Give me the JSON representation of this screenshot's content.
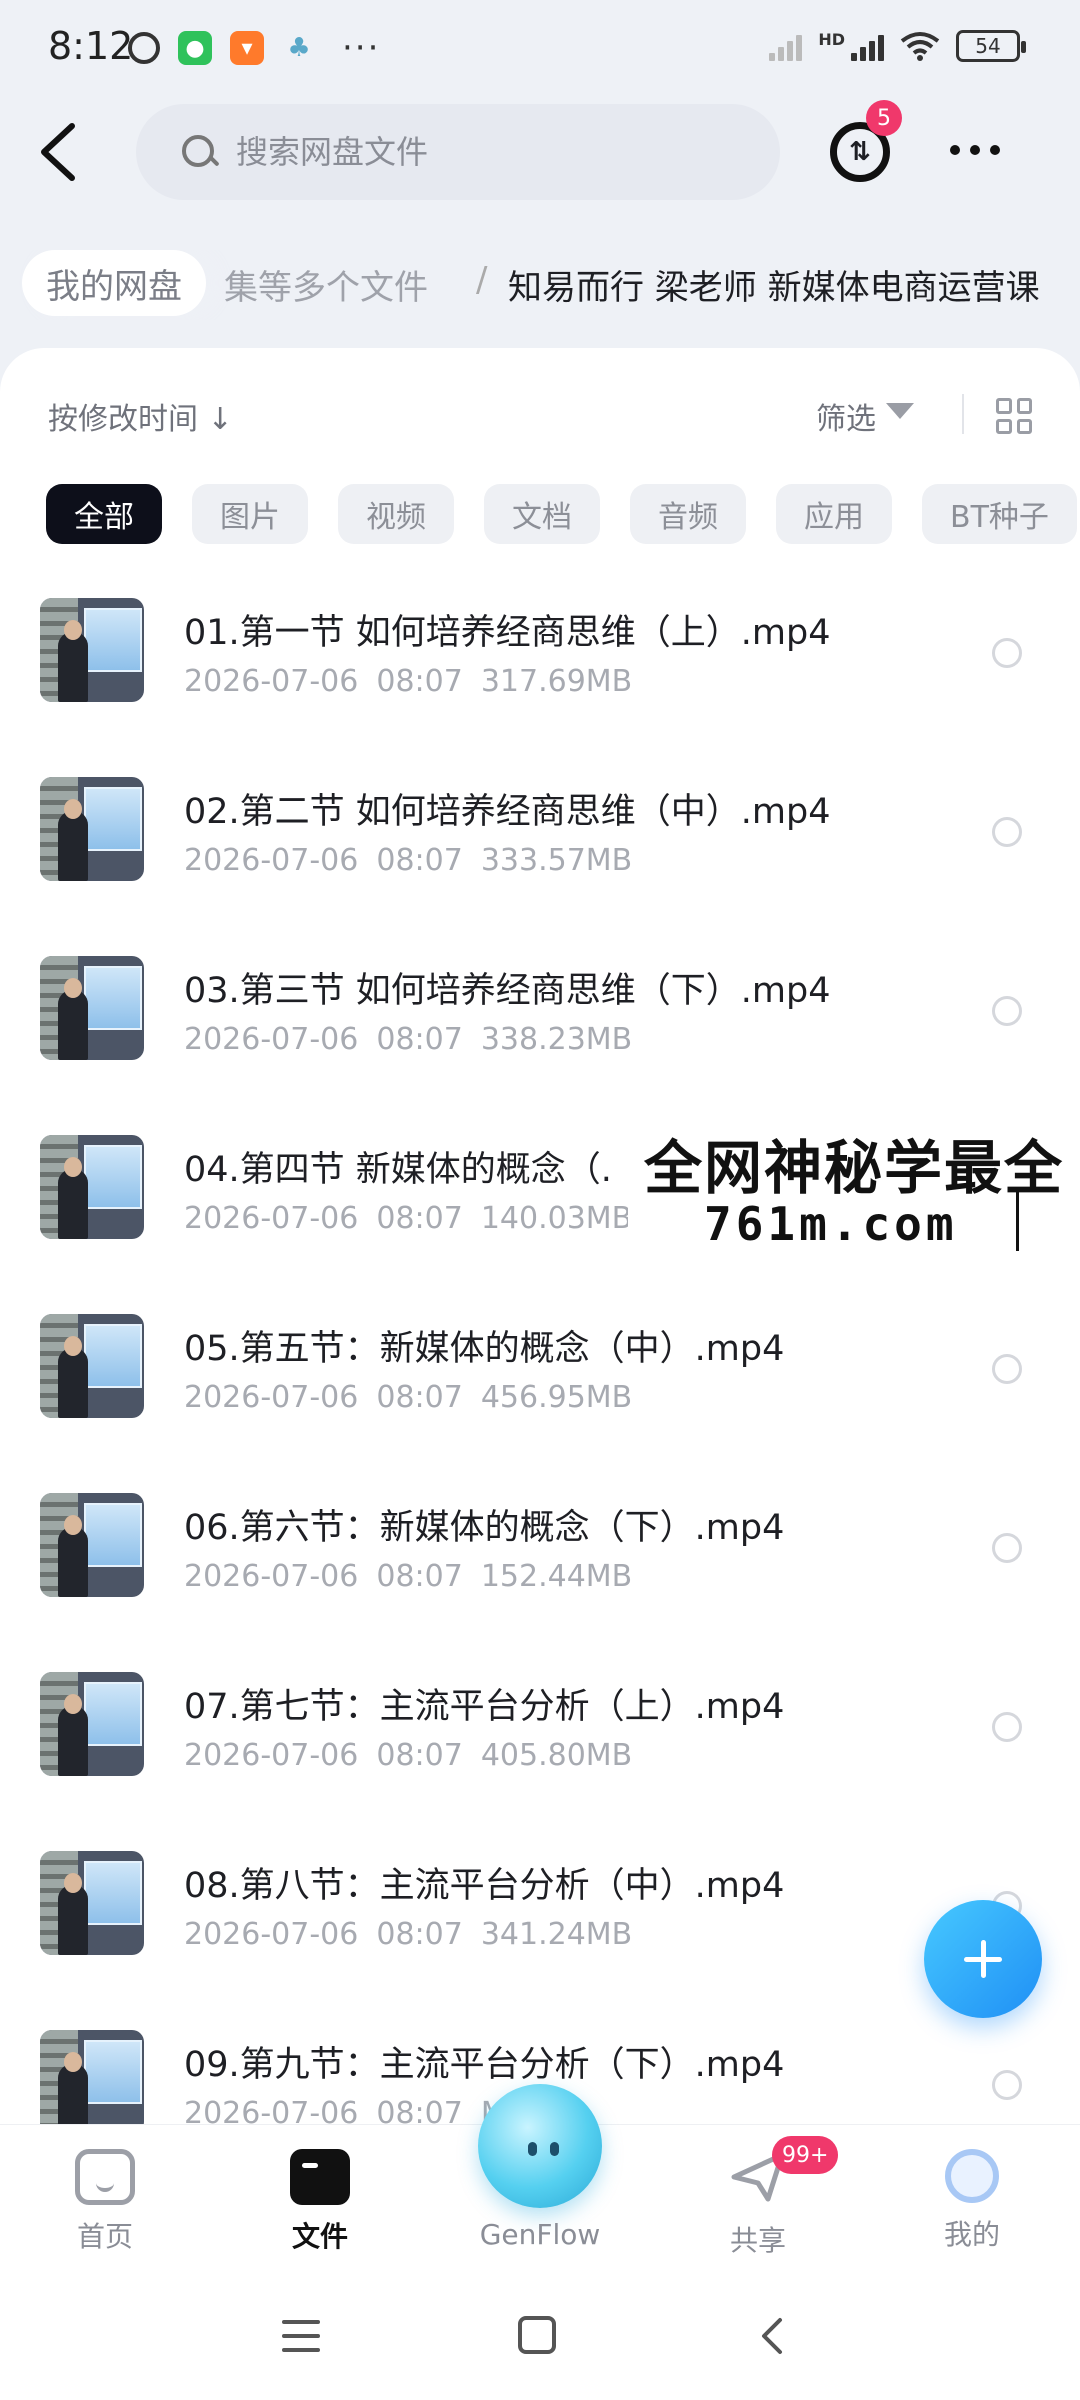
{
  "status_bar": {
    "time": "8:12",
    "more_indicator": "···",
    "network_hd": "HD",
    "battery": "54",
    "icons": [
      "alarm-icon",
      "wechat-icon",
      "taobao-icon",
      "clover-icon",
      "signal-icon",
      "wifi-icon",
      "battery-icon"
    ]
  },
  "header": {
    "search_placeholder": "搜索网盘文件",
    "transfer_badge": "5"
  },
  "breadcrumb": {
    "root": "我的网盘",
    "middle": "集等多个文件",
    "separator": "/",
    "current": "知易而行 梁老师 新媒体电商运营课"
  },
  "toolbar": {
    "sort_label": "按修改时间",
    "sort_arrow": "↓",
    "filter_label": "筛选"
  },
  "tabs": [
    {
      "label": "全部",
      "active": true
    },
    {
      "label": "图片",
      "active": false
    },
    {
      "label": "视频",
      "active": false
    },
    {
      "label": "文档",
      "active": false
    },
    {
      "label": "音频",
      "active": false
    },
    {
      "label": "应用",
      "active": false
    },
    {
      "label": "BT种子",
      "active": false
    }
  ],
  "files": [
    {
      "name": "01.第一节 如何培养经商思维（上）.mp4",
      "date": "2026-07-06",
      "time": "08:07",
      "size": "317.69MB"
    },
    {
      "name": "02.第二节 如何培养经商思维（中）.mp4",
      "date": "2026-07-06",
      "time": "08:07",
      "size": "333.57MB"
    },
    {
      "name": "03.第三节 如何培养经商思维（下）.mp4",
      "date": "2026-07-06",
      "time": "08:07",
      "size": "338.23MB"
    },
    {
      "name": "04.第四节 新媒体的概念（.",
      "date": "2026-07-06",
      "time": "08:07",
      "size": "140.03MB"
    },
    {
      "name": "05.第五节：新媒体的概念（中）.mp4",
      "date": "2026-07-06",
      "time": "08:07",
      "size": "456.95MB"
    },
    {
      "name": "06.第六节：新媒体的概念（下）.mp4",
      "date": "2026-07-06",
      "time": "08:07",
      "size": "152.44MB"
    },
    {
      "name": "07.第七节：主流平台分析（上）.mp4",
      "date": "2026-07-06",
      "time": "08:07",
      "size": "405.80MB"
    },
    {
      "name": "08.第八节：主流平台分析（中）.mp4",
      "date": "2026-07-06",
      "time": "08:07",
      "size": "341.24MB"
    },
    {
      "name": "09.第九节：主流平台分析（下）.mp4",
      "date": "2026-07-06",
      "time": "08:07",
      "size": "MB"
    }
  ],
  "watermark": {
    "line1": "全网神秘学最全",
    "line2": "761m.com"
  },
  "bottom_nav": {
    "home": "首页",
    "files": "文件",
    "genflow": "GenFlow",
    "share": "共享",
    "share_badge": "99+",
    "me": "我的"
  },
  "colors": {
    "accent_fab": "#1f8ff5",
    "badge": "#f0386b",
    "active_tab": "#0d0f1a"
  }
}
